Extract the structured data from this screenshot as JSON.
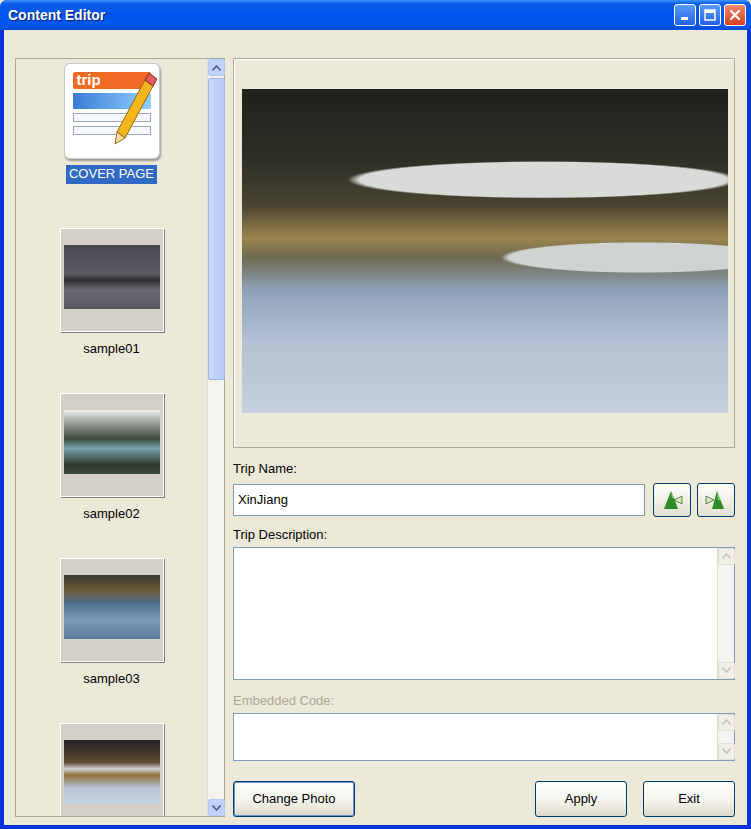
{
  "window": {
    "title": "Content Editor"
  },
  "pages": [
    {
      "label": "COVER PAGE",
      "selected": true,
      "kind": "cover",
      "icon_text": "trip"
    },
    {
      "label": "sample01",
      "selected": false,
      "kind": "photo"
    },
    {
      "label": "sample02",
      "selected": false,
      "kind": "photo"
    },
    {
      "label": "sample03",
      "selected": false,
      "kind": "photo"
    },
    {
      "selected": false,
      "kind": "photo"
    }
  ],
  "pages_scrollbar": {
    "level": 0.42
  },
  "trip_name": {
    "label": "Trip Name:",
    "value": "XinJiang"
  },
  "trip_description": {
    "label": "Trip Description:",
    "value": ""
  },
  "embedded_code": {
    "label": "Embedded Code:",
    "value": "",
    "disabled": true
  },
  "buttons": [
    {
      "label": "Change Photo",
      "focused": true
    },
    {
      "label": "Apply",
      "focused": false
    },
    {
      "label": "Exit",
      "focused": false
    }
  ]
}
